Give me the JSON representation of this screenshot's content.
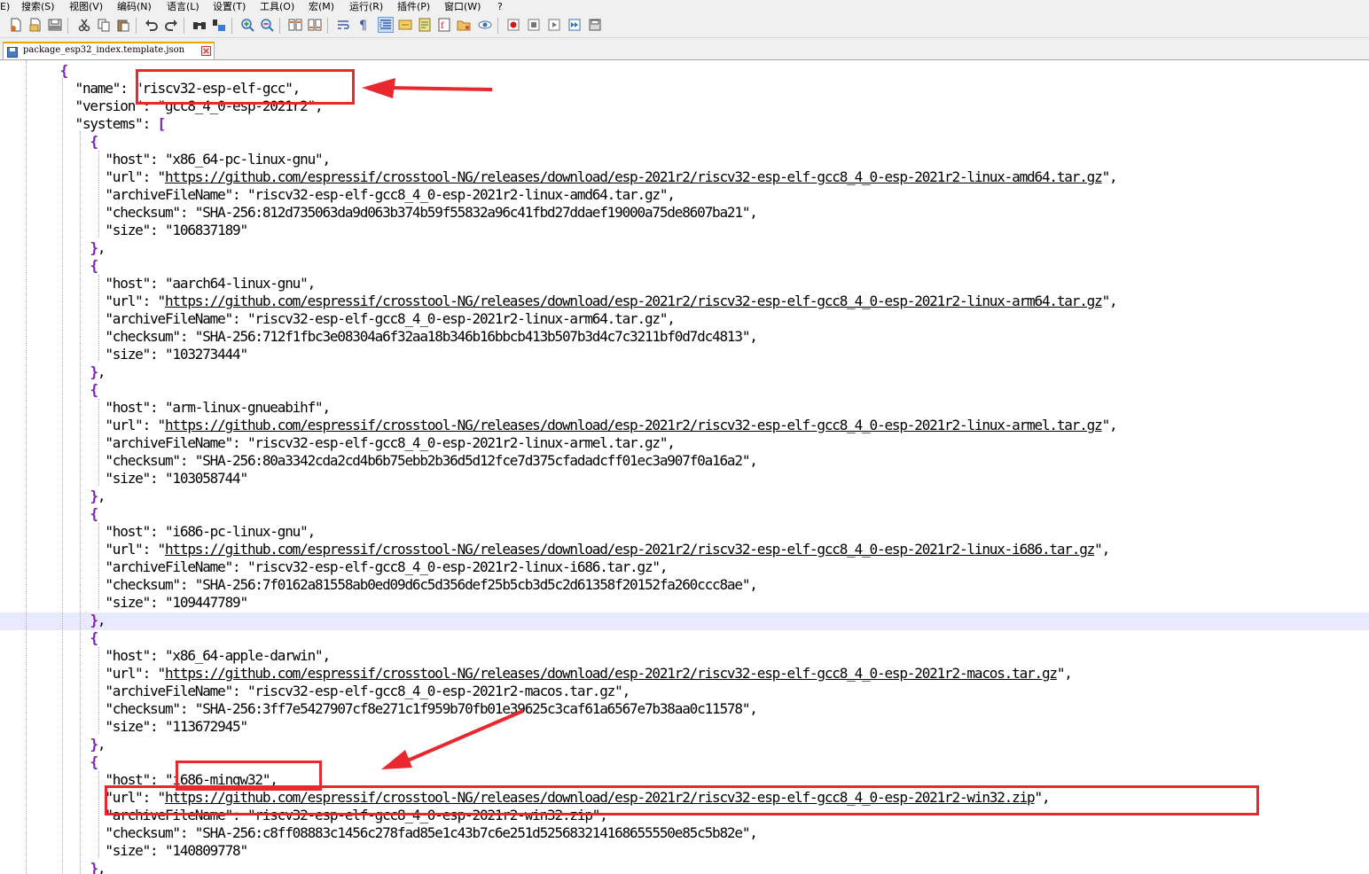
{
  "menu": {
    "items": [
      "E)",
      "搜索(S)",
      "视图(V)",
      "编码(N)",
      "语言(L)",
      "设置(T)",
      "工具(O)",
      "宏(M)",
      "运行(R)",
      "插件(P)",
      "窗口(W)",
      "?"
    ]
  },
  "toolbar": {
    "buttons": [
      "new-file-icon",
      "open-file-icon",
      "save-icon",
      "save-all-icon",
      "close-icon",
      "close-all-icon",
      "print-icon",
      "cut-icon",
      "copy-icon",
      "paste-icon",
      "undo-icon",
      "redo-icon",
      "find-icon",
      "replace-icon",
      "zoom-in-icon",
      "zoom-out-icon",
      "sync-vertical-icon",
      "sync-horizontal-icon",
      "word-wrap-icon",
      "show-all-chars-icon",
      "indent-guide-icon",
      "user-language-icon",
      "document-map-icon",
      "function-list-icon",
      "folder-as-workspace-icon",
      "monitoring-icon",
      "record-macro-icon",
      "stop-macro-icon",
      "play-macro-icon",
      "run-macro-multiple-icon",
      "save-macro-icon"
    ]
  },
  "tab": {
    "label": "package_esp32_index.template.json"
  },
  "code": {
    "lines": [
      [
        {
          "t": "        "
        },
        {
          "t": "{",
          "c": "br"
        }
      ],
      [
        {
          "t": "          \"name\": \"riscv32-esp-elf-gcc\","
        }
      ],
      [
        {
          "t": "          \"version\": \"gcc8_4_0-esp-2021r2\","
        }
      ],
      [
        {
          "t": "          \"systems\": "
        },
        {
          "t": "[",
          "c": "br"
        }
      ],
      [
        {
          "t": "            "
        },
        {
          "t": "{",
          "c": "br"
        }
      ],
      [
        {
          "t": "              \"host\": \"x86_64-pc-linux-gnu\","
        }
      ],
      [
        {
          "t": "              \"url\": \""
        },
        {
          "t": "https://github.com/espressif/crosstool-NG/releases/download/esp-2021r2/riscv32-esp-elf-gcc8_4_0-esp-2021r2-linux-amd64.tar.gz",
          "c": "u"
        },
        {
          "t": "\","
        }
      ],
      [
        {
          "t": "              \"archiveFileName\": \"riscv32-esp-elf-gcc8_4_0-esp-2021r2-linux-amd64.tar.gz\","
        }
      ],
      [
        {
          "t": "              \"checksum\": \"SHA-256:812d735063da9d063b374b59f55832a96c41fbd27ddaef19000a75de8607ba21\","
        }
      ],
      [
        {
          "t": "              \"size\": \"106837189\""
        }
      ],
      [
        {
          "t": "            "
        },
        {
          "t": "}",
          "c": "br"
        },
        {
          "t": ","
        }
      ],
      [
        {
          "t": "            "
        },
        {
          "t": "{",
          "c": "br"
        }
      ],
      [
        {
          "t": "              \"host\": \"aarch64-linux-gnu\","
        }
      ],
      [
        {
          "t": "              \"url\": \""
        },
        {
          "t": "https://github.com/espressif/crosstool-NG/releases/download/esp-2021r2/riscv32-esp-elf-gcc8_4_0-esp-2021r2-linux-arm64.tar.gz",
          "c": "u"
        },
        {
          "t": "\","
        }
      ],
      [
        {
          "t": "              \"archiveFileName\": \"riscv32-esp-elf-gcc8_4_0-esp-2021r2-linux-arm64.tar.gz\","
        }
      ],
      [
        {
          "t": "              \"checksum\": \"SHA-256:712f1fbc3e08304a6f32aa18b346b16bbcb413b507b3d4c7c3211bf0d7dc4813\","
        }
      ],
      [
        {
          "t": "              \"size\": \"103273444\""
        }
      ],
      [
        {
          "t": "            "
        },
        {
          "t": "}",
          "c": "br"
        },
        {
          "t": ","
        }
      ],
      [
        {
          "t": "            "
        },
        {
          "t": "{",
          "c": "br"
        }
      ],
      [
        {
          "t": "              \"host\": \"arm-linux-gnueabihf\","
        }
      ],
      [
        {
          "t": "              \"url\": \""
        },
        {
          "t": "https://github.com/espressif/crosstool-NG/releases/download/esp-2021r2/riscv32-esp-elf-gcc8_4_0-esp-2021r2-linux-armel.tar.gz",
          "c": "u"
        },
        {
          "t": "\","
        }
      ],
      [
        {
          "t": "              \"archiveFileName\": \"riscv32-esp-elf-gcc8_4_0-esp-2021r2-linux-armel.tar.gz\","
        }
      ],
      [
        {
          "t": "              \"checksum\": \"SHA-256:80a3342cda2cd4b6b75ebb2b36d5d12fce7d375cfadadcff01ec3a907f0a16a2\","
        }
      ],
      [
        {
          "t": "              \"size\": \"103058744\""
        }
      ],
      [
        {
          "t": "            "
        },
        {
          "t": "}",
          "c": "br"
        },
        {
          "t": ","
        }
      ],
      [
        {
          "t": "            "
        },
        {
          "t": "{",
          "c": "br"
        }
      ],
      [
        {
          "t": "              \"host\": \"i686-pc-linux-gnu\","
        }
      ],
      [
        {
          "t": "              \"url\": \""
        },
        {
          "t": "https://github.com/espressif/crosstool-NG/releases/download/esp-2021r2/riscv32-esp-elf-gcc8_4_0-esp-2021r2-linux-i686.tar.gz",
          "c": "u"
        },
        {
          "t": "\","
        }
      ],
      [
        {
          "t": "              \"archiveFileName\": \"riscv32-esp-elf-gcc8_4_0-esp-2021r2-linux-i686.tar.gz\","
        }
      ],
      [
        {
          "t": "              \"checksum\": \"SHA-256:7f0162a81558ab0ed09d6c5d356def25b5cb3d5c2d61358f20152fa260ccc8ae\","
        }
      ],
      [
        {
          "t": "              \"size\": \"109447789\""
        }
      ],
      [
        {
          "t": "            "
        },
        {
          "t": "}",
          "c": "br"
        },
        {
          "t": ","
        }
      ],
      [
        {
          "t": "            "
        },
        {
          "t": "{",
          "c": "br"
        }
      ],
      [
        {
          "t": "              \"host\": \"x86_64-apple-darwin\","
        }
      ],
      [
        {
          "t": "              \"url\": \""
        },
        {
          "t": "https://github.com/espressif/crosstool-NG/releases/download/esp-2021r2/riscv32-esp-elf-gcc8_4_0-esp-2021r2-macos.tar.gz",
          "c": "u"
        },
        {
          "t": "\","
        }
      ],
      [
        {
          "t": "              \"archiveFileName\": \"riscv32-esp-elf-gcc8_4_0-esp-2021r2-macos.tar.gz\","
        }
      ],
      [
        {
          "t": "              \"checksum\": \"SHA-256:3ff7e5427907cf8e271c1f959b70fb01e39625c3caf61a6567e7b38aa0c11578\","
        }
      ],
      [
        {
          "t": "              \"size\": \"113672945\""
        }
      ],
      [
        {
          "t": "            "
        },
        {
          "t": "}",
          "c": "br"
        },
        {
          "t": ","
        }
      ],
      [
        {
          "t": "            "
        },
        {
          "t": "{",
          "c": "br"
        }
      ],
      [
        {
          "t": "              \"host\": \"i686-mingw32\","
        }
      ],
      [
        {
          "t": "              \"url\": \""
        },
        {
          "t": "https://github.com/espressif/crosstool-NG/releases/download/esp-2021r2/riscv32-esp-elf-gcc8_4_0-esp-2021r2-win32.zip",
          "c": "u"
        },
        {
          "t": "\","
        }
      ],
      [
        {
          "t": "              \"archiveFileName\": \"riscv32-esp-elf-gcc8_4_0-esp-2021r2-win32.zip\","
        }
      ],
      [
        {
          "t": "              \"checksum\": \"SHA-256:c8ff08883c1456c278fad85e1c43b7c6e251d525683214168655550e85c5b82e\","
        }
      ],
      [
        {
          "t": "              \"size\": \"140809778\""
        }
      ],
      [
        {
          "t": "            "
        },
        {
          "t": "}",
          "c": "br"
        },
        {
          "t": ","
        }
      ]
    ]
  },
  "annotations": {
    "color": "#e8282e",
    "boxes": [
      "name-value-highlight",
      "host-i686-mingw32-highlight",
      "win32-url-highlight"
    ],
    "arrows": [
      "name-arrow",
      "mingw-arrow"
    ]
  }
}
